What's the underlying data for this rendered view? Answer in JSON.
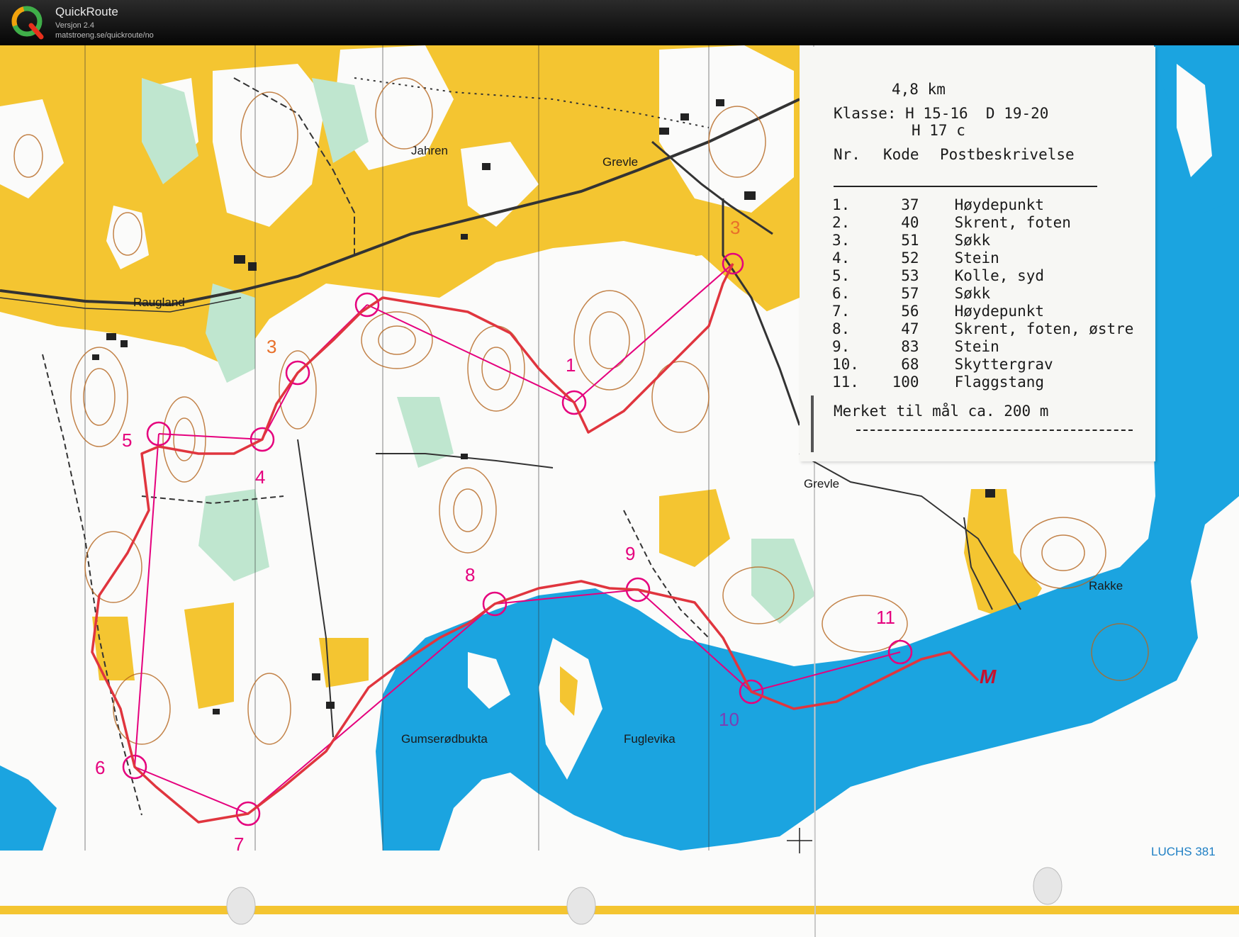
{
  "app": {
    "title": "QuickRoute",
    "version": "Versjon 2.4",
    "url": "matstroeng.se/quickroute/no"
  },
  "map": {
    "place_names": [
      {
        "label": "Jahren"
      },
      {
        "label": "Grevle"
      },
      {
        "label": "Raugland"
      },
      {
        "label": "Grevle"
      },
      {
        "label": "Rakke"
      },
      {
        "label": "Gumserødbukta"
      },
      {
        "label": "Fuglevika"
      }
    ],
    "control_numbers": [
      "1",
      "3",
      "4",
      "5",
      "6",
      "7",
      "8",
      "9",
      "10",
      "11",
      "3"
    ],
    "printer_mark": "LUCHS 381",
    "colors": {
      "open_land": "#f4c531",
      "forest": "#ffffff",
      "rough_green": "#bfe6cf",
      "water": "#1ba4e0",
      "contours": "#b5651d",
      "course": "#e5007d",
      "route": "#e0353e"
    }
  },
  "card": {
    "distance": "4,8 km",
    "class_line1": "Klasse: H 15-16  D 19-20",
    "class_line2": "H 17 c",
    "headers": {
      "nr": "Nr.",
      "kode": "Kode",
      "desc": "Postbeskrivelse"
    },
    "controls": [
      {
        "nr": "1.",
        "kode": "37",
        "desc": "Høydepunkt"
      },
      {
        "nr": "2.",
        "kode": "40",
        "desc": "Skrent, foten"
      },
      {
        "nr": "3.",
        "kode": "51",
        "desc": "Søkk"
      },
      {
        "nr": "4.",
        "kode": "52",
        "desc": "Stein"
      },
      {
        "nr": "5.",
        "kode": "53",
        "desc": "Kolle, syd"
      },
      {
        "nr": "6.",
        "kode": "57",
        "desc": "Søkk"
      },
      {
        "nr": "7.",
        "kode": "56",
        "desc": "Høydepunkt"
      },
      {
        "nr": "8.",
        "kode": "47",
        "desc": "Skrent, foten, østre"
      },
      {
        "nr": "9.",
        "kode": "83",
        "desc": "Stein"
      },
      {
        "nr": "10.",
        "kode": "68",
        "desc": "Skyttergrav"
      },
      {
        "nr": "11.",
        "kode": "100",
        "desc": "Flaggstang"
      }
    ],
    "finish_note": "Merket til mål ca. 200 m"
  }
}
